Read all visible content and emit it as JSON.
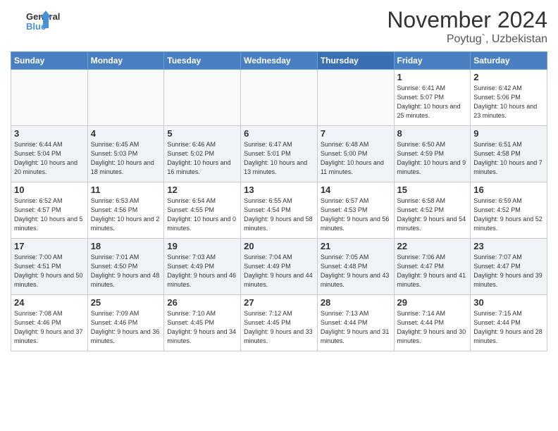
{
  "header": {
    "logo_general": "General",
    "logo_blue": "Blue",
    "title": "November 2024",
    "location": "Poytug`, Uzbekistan"
  },
  "days_of_week": [
    "Sunday",
    "Monday",
    "Tuesday",
    "Wednesday",
    "Thursday",
    "Friday",
    "Saturday"
  ],
  "weeks": [
    [
      {
        "day": "",
        "info": ""
      },
      {
        "day": "",
        "info": ""
      },
      {
        "day": "",
        "info": ""
      },
      {
        "day": "",
        "info": ""
      },
      {
        "day": "",
        "info": ""
      },
      {
        "day": "1",
        "info": "Sunrise: 6:41 AM\nSunset: 5:07 PM\nDaylight: 10 hours and 25 minutes."
      },
      {
        "day": "2",
        "info": "Sunrise: 6:42 AM\nSunset: 5:06 PM\nDaylight: 10 hours and 23 minutes."
      }
    ],
    [
      {
        "day": "3",
        "info": "Sunrise: 6:44 AM\nSunset: 5:04 PM\nDaylight: 10 hours and 20 minutes."
      },
      {
        "day": "4",
        "info": "Sunrise: 6:45 AM\nSunset: 5:03 PM\nDaylight: 10 hours and 18 minutes."
      },
      {
        "day": "5",
        "info": "Sunrise: 6:46 AM\nSunset: 5:02 PM\nDaylight: 10 hours and 16 minutes."
      },
      {
        "day": "6",
        "info": "Sunrise: 6:47 AM\nSunset: 5:01 PM\nDaylight: 10 hours and 13 minutes."
      },
      {
        "day": "7",
        "info": "Sunrise: 6:48 AM\nSunset: 5:00 PM\nDaylight: 10 hours and 11 minutes."
      },
      {
        "day": "8",
        "info": "Sunrise: 6:50 AM\nSunset: 4:59 PM\nDaylight: 10 hours and 9 minutes."
      },
      {
        "day": "9",
        "info": "Sunrise: 6:51 AM\nSunset: 4:58 PM\nDaylight: 10 hours and 7 minutes."
      }
    ],
    [
      {
        "day": "10",
        "info": "Sunrise: 6:52 AM\nSunset: 4:57 PM\nDaylight: 10 hours and 5 minutes."
      },
      {
        "day": "11",
        "info": "Sunrise: 6:53 AM\nSunset: 4:56 PM\nDaylight: 10 hours and 2 minutes."
      },
      {
        "day": "12",
        "info": "Sunrise: 6:54 AM\nSunset: 4:55 PM\nDaylight: 10 hours and 0 minutes."
      },
      {
        "day": "13",
        "info": "Sunrise: 6:55 AM\nSunset: 4:54 PM\nDaylight: 9 hours and 58 minutes."
      },
      {
        "day": "14",
        "info": "Sunrise: 6:57 AM\nSunset: 4:53 PM\nDaylight: 9 hours and 56 minutes."
      },
      {
        "day": "15",
        "info": "Sunrise: 6:58 AM\nSunset: 4:52 PM\nDaylight: 9 hours and 54 minutes."
      },
      {
        "day": "16",
        "info": "Sunrise: 6:59 AM\nSunset: 4:52 PM\nDaylight: 9 hours and 52 minutes."
      }
    ],
    [
      {
        "day": "17",
        "info": "Sunrise: 7:00 AM\nSunset: 4:51 PM\nDaylight: 9 hours and 50 minutes."
      },
      {
        "day": "18",
        "info": "Sunrise: 7:01 AM\nSunset: 4:50 PM\nDaylight: 9 hours and 48 minutes."
      },
      {
        "day": "19",
        "info": "Sunrise: 7:03 AM\nSunset: 4:49 PM\nDaylight: 9 hours and 46 minutes."
      },
      {
        "day": "20",
        "info": "Sunrise: 7:04 AM\nSunset: 4:49 PM\nDaylight: 9 hours and 44 minutes."
      },
      {
        "day": "21",
        "info": "Sunrise: 7:05 AM\nSunset: 4:48 PM\nDaylight: 9 hours and 43 minutes."
      },
      {
        "day": "22",
        "info": "Sunrise: 7:06 AM\nSunset: 4:47 PM\nDaylight: 9 hours and 41 minutes."
      },
      {
        "day": "23",
        "info": "Sunrise: 7:07 AM\nSunset: 4:47 PM\nDaylight: 9 hours and 39 minutes."
      }
    ],
    [
      {
        "day": "24",
        "info": "Sunrise: 7:08 AM\nSunset: 4:46 PM\nDaylight: 9 hours and 37 minutes."
      },
      {
        "day": "25",
        "info": "Sunrise: 7:09 AM\nSunset: 4:46 PM\nDaylight: 9 hours and 36 minutes."
      },
      {
        "day": "26",
        "info": "Sunrise: 7:10 AM\nSunset: 4:45 PM\nDaylight: 9 hours and 34 minutes."
      },
      {
        "day": "27",
        "info": "Sunrise: 7:12 AM\nSunset: 4:45 PM\nDaylight: 9 hours and 33 minutes."
      },
      {
        "day": "28",
        "info": "Sunrise: 7:13 AM\nSunset: 4:44 PM\nDaylight: 9 hours and 31 minutes."
      },
      {
        "day": "29",
        "info": "Sunrise: 7:14 AM\nSunset: 4:44 PM\nDaylight: 9 hours and 30 minutes."
      },
      {
        "day": "30",
        "info": "Sunrise: 7:15 AM\nSunset: 4:44 PM\nDaylight: 9 hours and 28 minutes."
      }
    ]
  ]
}
